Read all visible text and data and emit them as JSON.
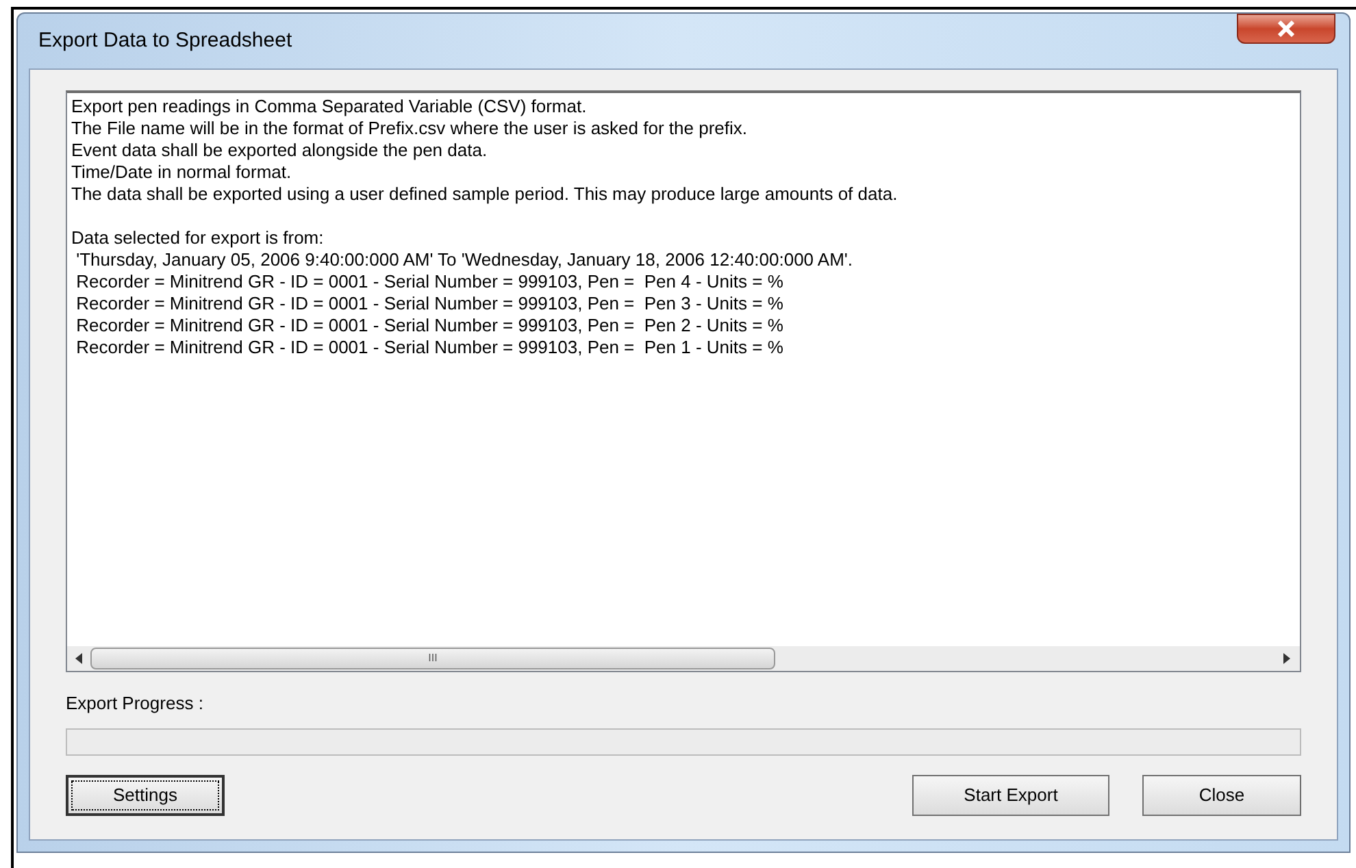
{
  "window": {
    "title": "Export Data to Spreadsheet"
  },
  "message": {
    "paragraphs": [
      [
        "Export pen readings in Comma Separated Variable (CSV) format.",
        "The File name will be in the format of Prefix.csv where the user is asked for the prefix.",
        "Event data shall be exported alongside the pen data.",
        "Time/Date in normal format.",
        "The data shall be exported using a user defined sample period. This may produce large amounts of data."
      ],
      [
        "Data selected for export is from:",
        " 'Thursday, January 05, 2006 9:40:00:000 AM' To 'Wednesday, January 18, 2006 12:40:00:000 AM'.",
        " Recorder = Minitrend GR - ID = 0001 - Serial Number = 999103, Pen =  Pen 4 - Units = %",
        " Recorder = Minitrend GR - ID = 0001 - Serial Number = 999103, Pen =  Pen 3 - Units = %",
        " Recorder = Minitrend GR - ID = 0001 - Serial Number = 999103, Pen =  Pen 2 - Units = %",
        " Recorder = Minitrend GR - ID = 0001 - Serial Number = 999103, Pen =  Pen 1 - Units = %"
      ]
    ],
    "scrollbar_thumb": "III"
  },
  "progress": {
    "label": "Export Progress :",
    "level": 0
  },
  "buttons": [
    {
      "label": "Settings",
      "focused": true
    },
    {
      "label": "Start Export",
      "focused": false
    },
    {
      "label": "Close",
      "focused": false
    }
  ]
}
